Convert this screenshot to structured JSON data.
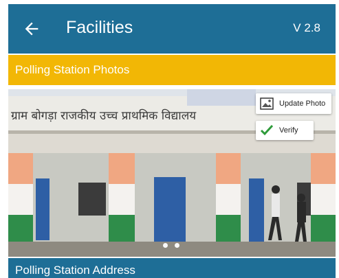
{
  "appbar": {
    "title": "Facilities",
    "version": "V 2.8",
    "back_icon": "arrow-left-icon",
    "color": "#1e6e96"
  },
  "photos_section": {
    "title": "Polling Station Photos",
    "color": "#f2b705",
    "signboard_text": "ग्राम बोगड़ा राजकीय उच्च प्राथमिक विद्यालय",
    "buttons": {
      "update_label": "Update Photo",
      "verify_label": "Verify",
      "update_icon": "image-icon",
      "verify_icon": "checkmark-icon"
    },
    "pager": {
      "count": 2
    }
  },
  "address_section": {
    "title": "Polling Station Address"
  }
}
